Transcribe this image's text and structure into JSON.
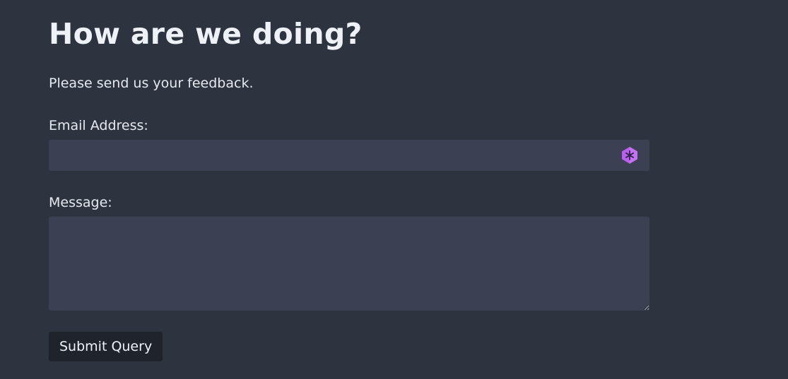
{
  "page": {
    "title": "How are we doing?",
    "subtitle": "Please send us your feedback."
  },
  "form": {
    "email_label": "Email Address:",
    "email_value": "",
    "email_icon": "extension-hexagon-icon",
    "message_label": "Message:",
    "message_value": "",
    "submit_label": "Submit Query"
  },
  "colors": {
    "background": "#2e3340",
    "input_background": "#3b4152",
    "button_background": "#1f232c",
    "text": "#e6e9ef",
    "icon_accent": "#b95ff0"
  }
}
